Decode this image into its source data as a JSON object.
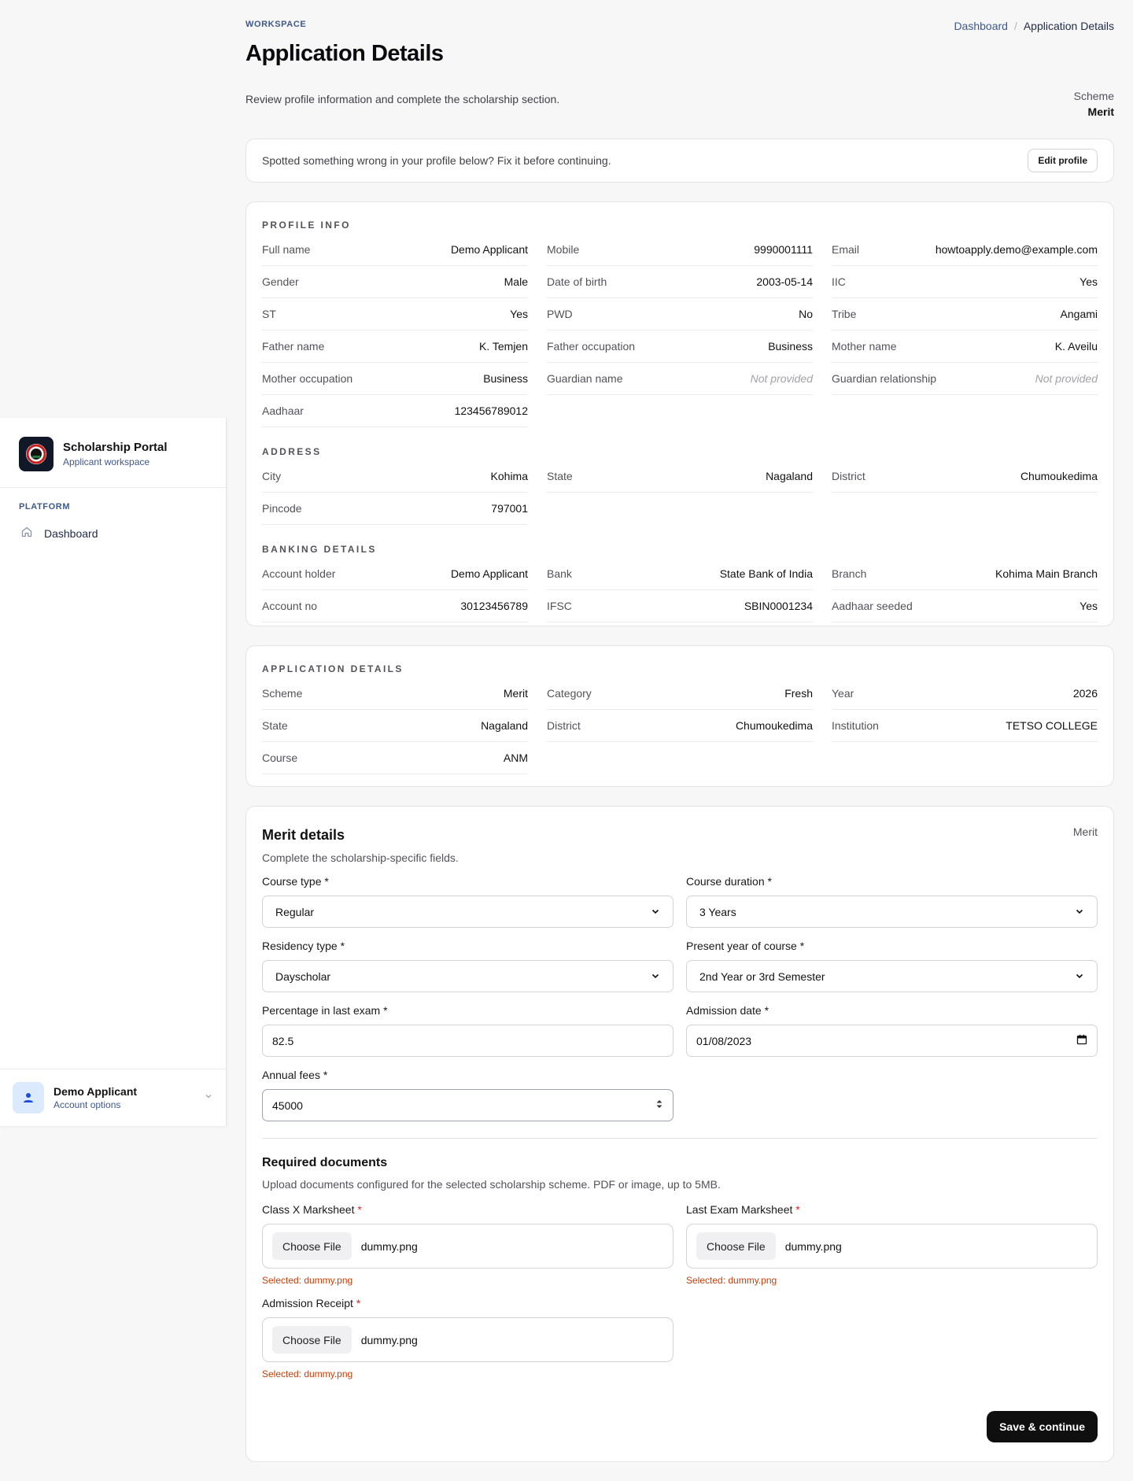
{
  "sidebar": {
    "brand_title": "Scholarship Portal",
    "brand_subtitle": "Applicant workspace",
    "section": "PLATFORM",
    "nav": [
      {
        "label": "Dashboard",
        "icon": "home-icon"
      }
    ],
    "user_name": "Demo Applicant",
    "user_sub": "Account options"
  },
  "header": {
    "eyebrow": "WORKSPACE",
    "title": "Application Details",
    "subtitle": "Review profile information and complete the scholarship section.",
    "breadcrumb": [
      "Dashboard",
      "Application Details"
    ],
    "scheme_label": "Scheme",
    "scheme_value": "Merit"
  },
  "alert": {
    "text": "Spotted something wrong in your profile below? Fix it before continuing.",
    "button": "Edit profile"
  },
  "profile": {
    "info_title": "PROFILE INFO",
    "info": [
      {
        "k": "Full name",
        "v": "Demo Applicant"
      },
      {
        "k": "Mobile",
        "v": "9990001111"
      },
      {
        "k": "Email",
        "v": "howtoapply.demo@example.com"
      },
      {
        "k": "Gender",
        "v": "Male"
      },
      {
        "k": "Date of birth",
        "v": "2003-05-14"
      },
      {
        "k": "IIC",
        "v": "Yes"
      },
      {
        "k": "ST",
        "v": "Yes"
      },
      {
        "k": "PWD",
        "v": "No"
      },
      {
        "k": "Tribe",
        "v": "Angami"
      },
      {
        "k": "Father name",
        "v": "K. Temjen"
      },
      {
        "k": "Father occupation",
        "v": "Business"
      },
      {
        "k": "Mother name",
        "v": "K. Aveilu"
      },
      {
        "k": "Mother occupation",
        "v": "Business"
      },
      {
        "k": "Guardian name",
        "v": "Not provided"
      },
      {
        "k": "Guardian relationship",
        "v": "Not provided"
      },
      {
        "k": "Aadhaar",
        "v": "123456789012"
      }
    ],
    "address_title": "ADDRESS",
    "address": [
      {
        "k": "City",
        "v": "Kohima"
      },
      {
        "k": "State",
        "v": "Nagaland"
      },
      {
        "k": "District",
        "v": "Chumoukedima"
      },
      {
        "k": "Pincode",
        "v": "797001"
      }
    ],
    "banking_title": "BANKING DETAILS",
    "banking": [
      {
        "k": "Account holder",
        "v": "Demo Applicant"
      },
      {
        "k": "Bank",
        "v": "State Bank of India"
      },
      {
        "k": "Branch",
        "v": "Kohima Main Branch"
      },
      {
        "k": "Account no",
        "v": "30123456789"
      },
      {
        "k": "IFSC",
        "v": "SBIN0001234"
      },
      {
        "k": "Aadhaar seeded",
        "v": "Yes"
      }
    ]
  },
  "application": {
    "title": "APPLICATION DETAILS",
    "items": [
      {
        "k": "Scheme",
        "v": "Merit"
      },
      {
        "k": "Category",
        "v": "Fresh"
      },
      {
        "k": "Year",
        "v": "2026"
      },
      {
        "k": "State",
        "v": "Nagaland"
      },
      {
        "k": "District",
        "v": "Chumoukedima"
      },
      {
        "k": "Institution",
        "v": "TETSO COLLEGE"
      },
      {
        "k": "Course",
        "v": "ANM"
      }
    ]
  },
  "merit": {
    "title": "Merit details",
    "tag": "Merit",
    "subtitle": "Complete the scholarship-specific fields.",
    "fields": {
      "course_type": {
        "label": "Course type *",
        "value": "Regular"
      },
      "course_duration": {
        "label": "Course duration *",
        "value": "3 Years"
      },
      "residency_type": {
        "label": "Residency type *",
        "value": "Dayscholar"
      },
      "present_year": {
        "label": "Present year of course *",
        "value": "2nd Year or 3rd Semester"
      },
      "percentage": {
        "label": "Percentage in last exam *",
        "value": "82.5"
      },
      "admission_date": {
        "label": "Admission date *",
        "value": "01/08/2023"
      },
      "annual_fees": {
        "label": "Annual fees *",
        "value": "45000"
      }
    },
    "docs_title": "Required documents",
    "docs_subtitle": "Upload documents configured for the selected scholarship scheme. PDF or image, up to 5MB.",
    "choose_label": "Choose File",
    "docs": [
      {
        "label": "Class X Marksheet",
        "file": "dummy.png",
        "selected": "Selected: dummy.png"
      },
      {
        "label": "Last Exam Marksheet",
        "file": "dummy.png",
        "selected": "Selected: dummy.png"
      },
      {
        "label": "Admission Receipt",
        "file": "dummy.png",
        "selected": "Selected: dummy.png"
      }
    ],
    "submit": "Save & continue"
  }
}
